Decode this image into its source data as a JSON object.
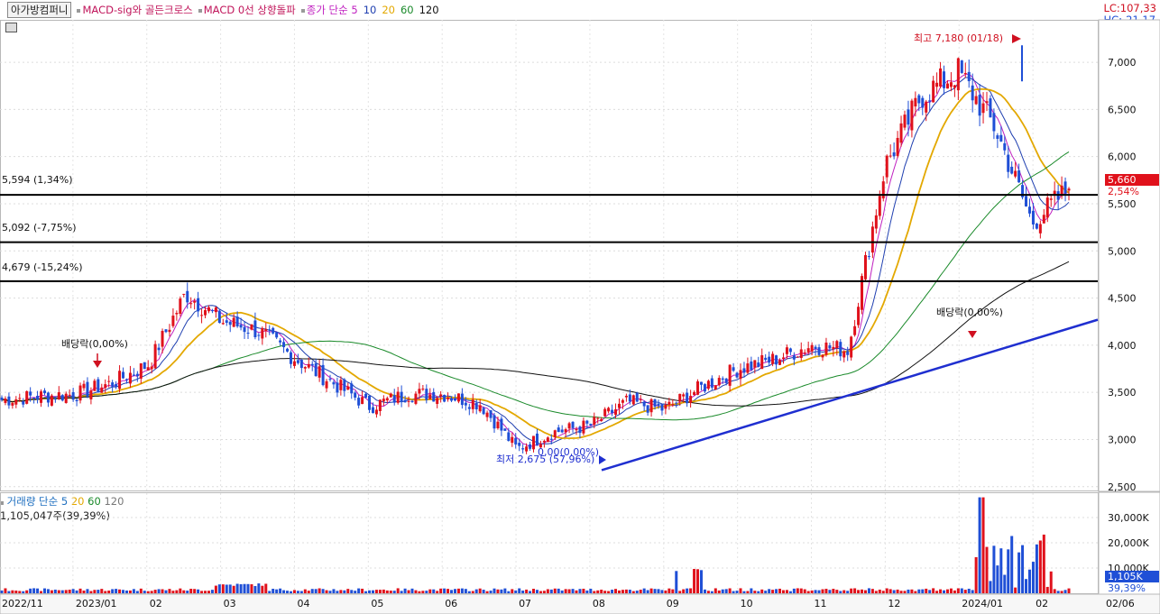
{
  "legend": {
    "title": "아가방컴퍼니",
    "indicators": [
      "MACD-sig와 골든크로스",
      "MACD 0선 상향돌파"
    ],
    "price_ma_label": "종가 단순 5",
    "ma_periods": [
      "10",
      "20",
      "60",
      "120"
    ]
  },
  "volume_legend": {
    "label": "거래량 단순 5",
    "ma_periods": [
      "20",
      "60",
      "120"
    ],
    "current": "1,105,047주(39,39%)"
  },
  "lc": "LC:107,33",
  "hc": "HC:-21,17",
  "horizontal_lines": [
    {
      "label": "5,594 (1,34%)",
      "value": 5594
    },
    {
      "label": "5,092 (-7,75%)",
      "value": 5092
    },
    {
      "label": "4,679 (-15,24%)",
      "value": 4679
    }
  ],
  "annotations": {
    "high": "최고 7,180 (01/18)",
    "low": "최저 2,675 (57,96%)",
    "low_overlap": "0,00(0,00%)",
    "dividend_1": "배당락(0,00%)",
    "dividend_2": "배당락(0,00%)"
  },
  "price_tag": "5,660",
  "price_change": "2,54%",
  "volume_tag": "1,105K",
  "volume_pct": "39,39%",
  "colors": {
    "up": "#e0111b",
    "down": "#1f4fd6",
    "ma5": "#c020c0",
    "ma10": "#1f3fb0",
    "ma20": "#e3a800",
    "ma60": "#1a8a2a",
    "ma120": "#111111",
    "trend": "#1f2fd0"
  },
  "chart_data": {
    "type": "candlestick",
    "price_axis_ticks": [
      "7,000",
      "6,500",
      "6,000",
      "5,500",
      "5,000",
      "4,500",
      "4,000",
      "3,500",
      "3,000",
      "2,500"
    ],
    "price_range": [
      2450,
      7450
    ],
    "x_labels": [
      "2022/11",
      "2023/01",
      "02",
      "03",
      "04",
      "05",
      "06",
      "07",
      "08",
      "09",
      "10",
      "11",
      "12",
      "2024/01",
      "02",
      "02/06"
    ],
    "volume_axis_ticks": [
      "30,000K",
      "20,000K",
      "10,000K"
    ],
    "volume_range": [
      0,
      40000
    ],
    "price_path": [
      [
        "2022/11",
        3420
      ],
      [
        "2022/12",
        3460
      ],
      [
        "2023/01",
        3480
      ],
      [
        "2023/02",
        3600
      ],
      [
        "2023/02 end",
        3800
      ],
      [
        "2023/03 early",
        4550
      ],
      [
        "2023/03 mid",
        4250
      ],
      [
        "2023/03 end",
        4150
      ],
      [
        "2023/04",
        3850
      ],
      [
        "2023/04 end",
        3600
      ],
      [
        "2023/05",
        3350
      ],
      [
        "2023/05 end",
        3480
      ],
      [
        "2023/06",
        3480
      ],
      [
        "2023/07",
        3380
      ],
      [
        "2023/07 end",
        2900
      ],
      [
        "2023/08",
        3080
      ],
      [
        "2023/08 end",
        3150
      ],
      [
        "2023/09",
        3400
      ],
      [
        "2023/10",
        3320
      ],
      [
        "2023/10 end",
        3550
      ],
      [
        "2023/11",
        3750
      ],
      [
        "2023/11 end",
        3850
      ],
      [
        "2023/12",
        4000
      ],
      [
        "2023/12 end",
        3950
      ],
      [
        "2024/01 early",
        5900
      ],
      [
        "2024/01 mid",
        6650
      ],
      [
        "2024/01 high",
        6900
      ],
      [
        "2024/01 end",
        6300
      ],
      [
        "2024/02",
        5300
      ],
      [
        "2024/02/06",
        5660
      ]
    ],
    "high": 7180,
    "low": 2675,
    "last": 5660
  }
}
